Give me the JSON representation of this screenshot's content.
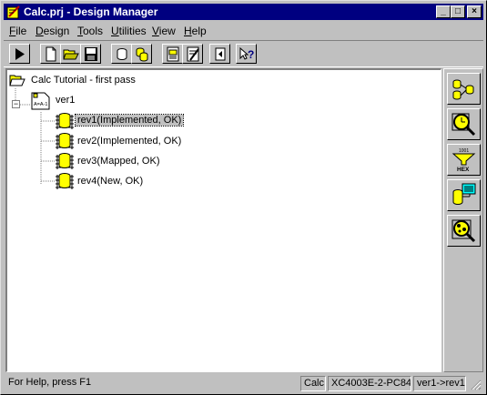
{
  "window": {
    "title": "Calc.prj - Design Manager",
    "buttons": {
      "minimize": "_",
      "maximize": "□",
      "close": "×"
    }
  },
  "menubar": {
    "items": [
      {
        "label": "File",
        "underline": "F",
        "rest": "ile"
      },
      {
        "label": "Design",
        "underline": "D",
        "rest": "esign"
      },
      {
        "label": "Tools",
        "underline": "T",
        "rest": "ools"
      },
      {
        "label": "Utilities",
        "underline": "U",
        "rest": "tilities"
      },
      {
        "label": "View",
        "underline": "V",
        "rest": "iew"
      },
      {
        "label": "Help",
        "underline": "H",
        "rest": "elp"
      }
    ]
  },
  "toolbar": {
    "buttons": [
      {
        "name": "run-icon"
      },
      {
        "name": "new-file-icon"
      },
      {
        "name": "open-folder-icon"
      },
      {
        "name": "save-icon"
      },
      {
        "name": "chip-single-icon"
      },
      {
        "name": "chip-multiple-icon"
      },
      {
        "name": "report-icon"
      },
      {
        "name": "edit-report-icon"
      },
      {
        "name": "back-icon"
      },
      {
        "name": "context-help-icon"
      }
    ]
  },
  "tree": {
    "project": "Calc Tutorial - first pass",
    "version": "ver1",
    "version_icon_text": "A=A-1",
    "revisions": [
      {
        "label": "rev1(Implemented, OK)",
        "selected": true
      },
      {
        "label": "rev2(Implemented, OK)",
        "selected": false
      },
      {
        "label": "rev3(Mapped, OK)",
        "selected": false
      },
      {
        "label": "rev4(New, OK)",
        "selected": false
      }
    ],
    "expander": "−"
  },
  "sidebar": {
    "buttons": [
      {
        "name": "flow-engine-icon"
      },
      {
        "name": "timing-analyzer-icon"
      },
      {
        "name": "prom-file-formatter-icon",
        "text": "HEX",
        "sub": "1001"
      },
      {
        "name": "hardware-debugger-icon"
      },
      {
        "name": "epic-design-editor-icon"
      }
    ]
  },
  "status": {
    "help": "For Help, press F1",
    "project": "Calc",
    "device": "XC4003E-2-PC84",
    "revision": "ver1->rev1"
  },
  "colors": {
    "titlebar": "#000080",
    "face": "#c0c0c0",
    "chip_yellow": "#ffff00",
    "selected_bg": "#c0c0c0"
  }
}
